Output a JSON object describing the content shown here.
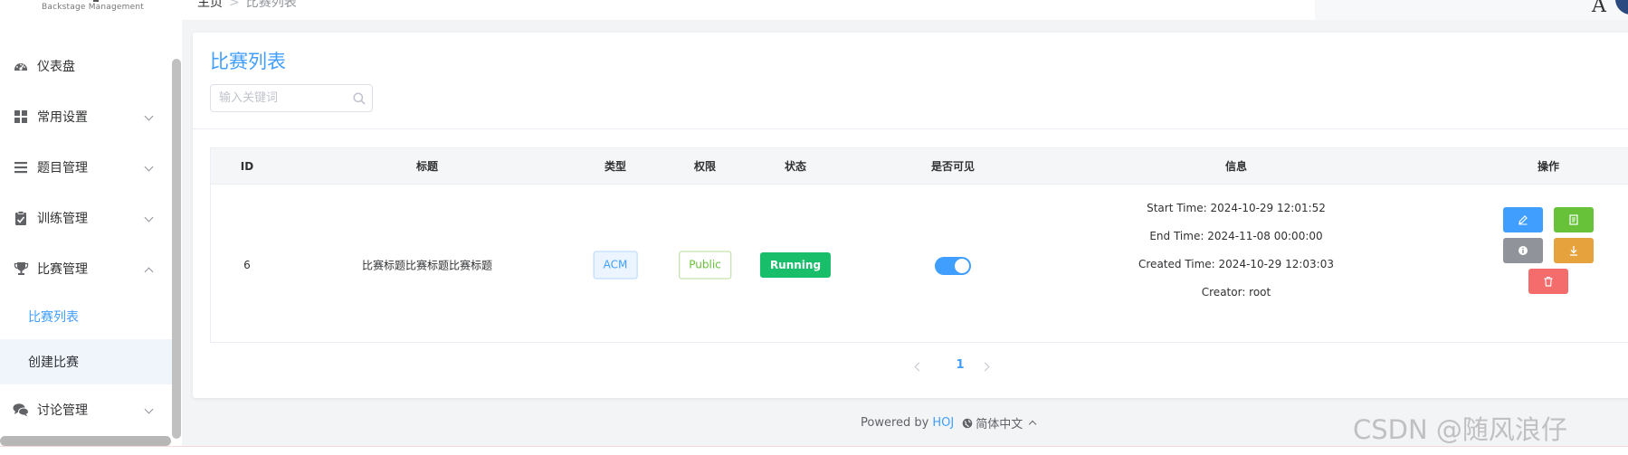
{
  "brand": {
    "subtitle": "Backstage Management"
  },
  "header": {
    "breadcrumb": [
      "主页",
      "比赛列表"
    ],
    "user_initial": "A"
  },
  "sidebar": {
    "items": [
      {
        "label": "仪表盘",
        "icon": "dashboard-icon"
      },
      {
        "label": "常用设置",
        "icon": "grid-icon",
        "expandable": true
      },
      {
        "label": "题目管理",
        "icon": "list-icon",
        "expandable": true
      },
      {
        "label": "训练管理",
        "icon": "clipboard-icon",
        "expandable": true
      },
      {
        "label": "比赛管理",
        "icon": "trophy-icon",
        "expandable": true,
        "expanded": true,
        "children": [
          {
            "label": "比赛列表",
            "active": true
          },
          {
            "label": "创建比赛"
          }
        ]
      },
      {
        "label": "讨论管理",
        "icon": "chat-icon",
        "expandable": true
      }
    ]
  },
  "main": {
    "title": "比赛列表",
    "search": {
      "placeholder": "输入关键词",
      "value": ""
    },
    "table": {
      "columns": [
        "ID",
        "标题",
        "类型",
        "权限",
        "状态",
        "是否可见",
        "信息",
        "操作"
      ],
      "rows": [
        {
          "id": "6",
          "title": "比赛标题比赛标题比赛标题",
          "type": "ACM",
          "auth": "Public",
          "status": "Running",
          "visible": true,
          "info": [
            "Start Time: 2024-10-29 12:01:52",
            "End Time: 2024-11-08 00:00:00",
            "Created Time: 2024-10-29 12:03:03",
            "Creator: root"
          ],
          "actions": [
            "edit-icon",
            "document-icon",
            "info-icon",
            "download-icon",
            "delete-icon"
          ]
        }
      ]
    },
    "pagination": {
      "current": "1"
    }
  },
  "footer": {
    "powered_by": "Powered by",
    "brand": "HOJ",
    "language": "简体中文"
  },
  "watermark": "CSDN @随风浪仔",
  "colors": {
    "primary": "#409eff",
    "success": "#67c23a",
    "running": "#19be6b",
    "warning": "#e6a23c",
    "danger": "#f56c6c",
    "info": "#909399"
  }
}
